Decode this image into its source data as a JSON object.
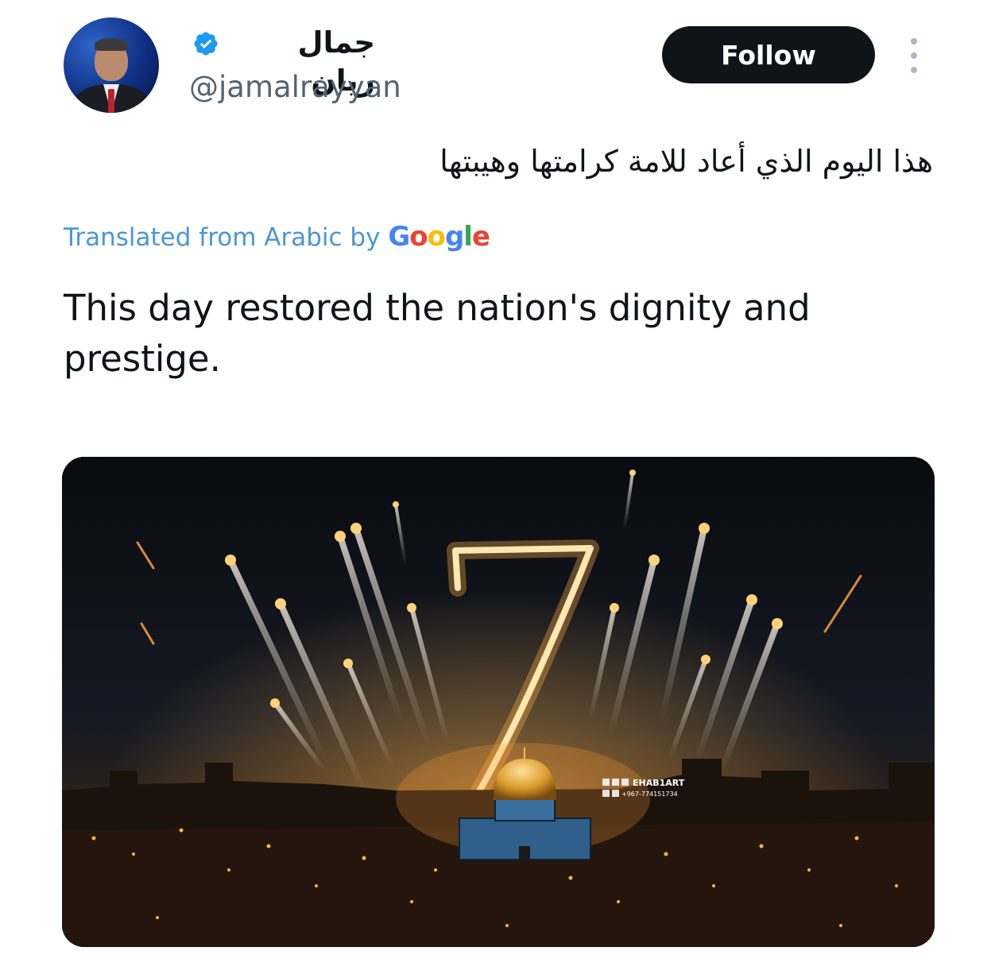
{
  "author": {
    "display_name": "جمال ريان",
    "handle": "@jamalrayyan",
    "verified": true
  },
  "actions": {
    "follow_label": "Follow"
  },
  "tweet": {
    "text": "هذا اليوم الذي أعاد للامة كرامتها وهيبتها",
    "translated_label": "Translated from Arabic by",
    "translator_brand": "Google",
    "translation": "This day restored the nation's dignity and prestige."
  },
  "media": {
    "big_numeral": "7",
    "watermark_name": "EHAB1ART",
    "watermark_phone": "+967-774151734"
  },
  "colors": {
    "accent_blue": "#1d9bf0",
    "translated_text": "#4a96d9",
    "follow_bg": "#0f1419",
    "handle_gray": "#536471"
  }
}
